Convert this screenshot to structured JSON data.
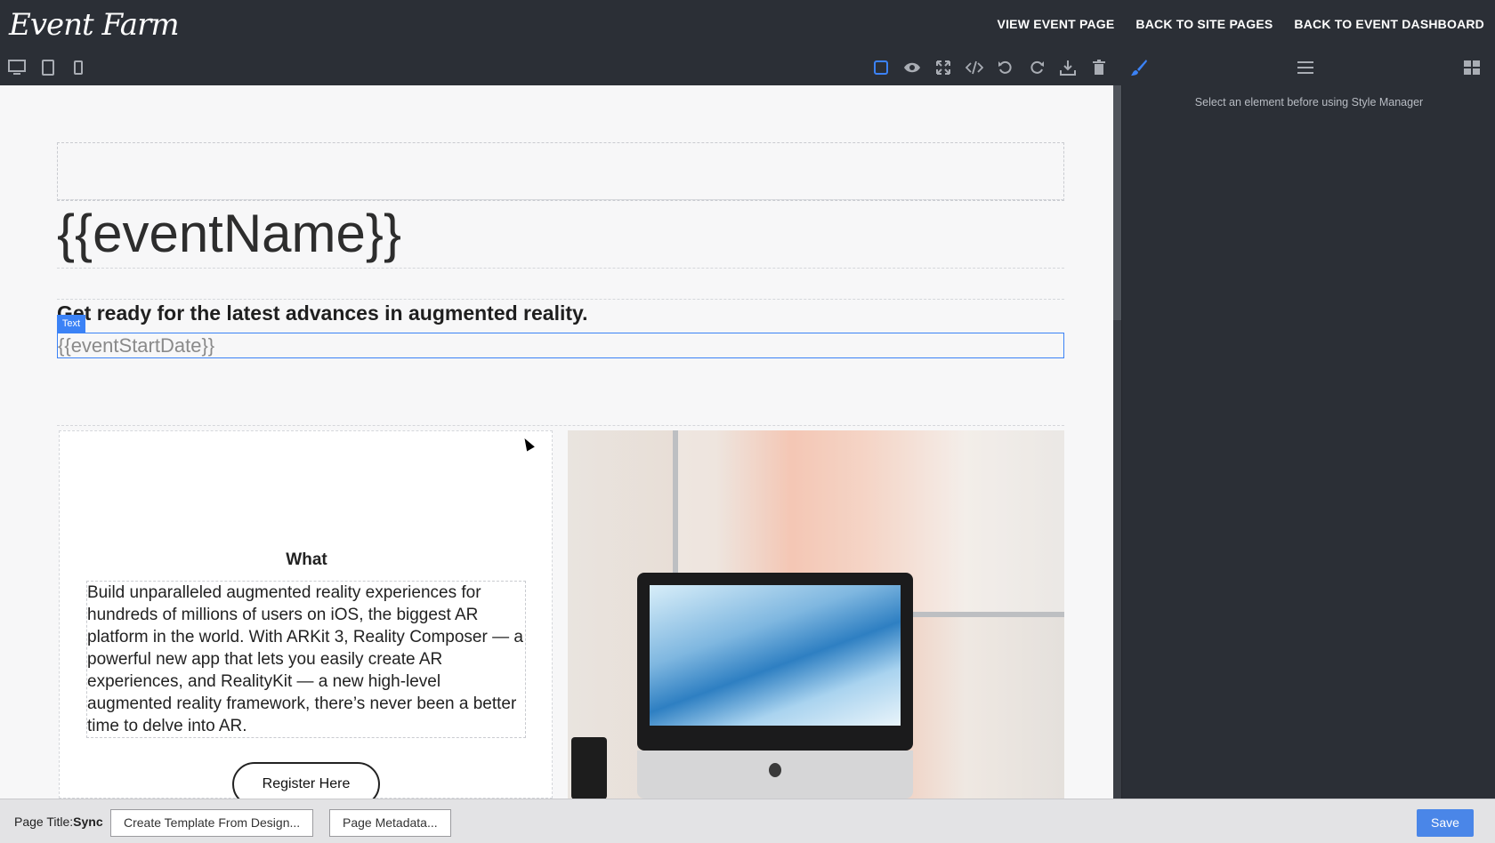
{
  "app": {
    "logo_text": "Event Farm",
    "nav": [
      "VIEW EVENT PAGE",
      "BACK TO SITE PAGES",
      "BACK TO EVENT DASHBOARD"
    ]
  },
  "toolbar": {
    "device_icons": [
      "desktop-icon",
      "tablet-icon",
      "mobile-icon"
    ],
    "tool_icons": [
      "select-outline-icon",
      "preview-eye-icon",
      "fullscreen-icon",
      "code-icon",
      "undo-icon",
      "redo-icon",
      "download-icon",
      "trash-icon"
    ],
    "panel_icons": [
      "style-brush-icon",
      "layers-menu-icon",
      "blocks-grid-icon"
    ],
    "accent": "#3b82f6"
  },
  "canvas": {
    "event_name": "{{eventName}}",
    "subtitle": "Get ready for the latest advances in augmented reality.",
    "selected_tag": "Text",
    "event_start_date": "{{eventStartDate}}",
    "section_heading": "What",
    "description": "Build unparalleled augmented reality experiences for hundreds of millions of users on iOS, the biggest AR platform in the world. With ARKit 3, Reality Composer — a powerful new app that lets you easily create AR experiences, and RealityKit — a new high-level augmented reality framework, there’s never been a better time to delve into AR.",
    "register_label": "Register Here"
  },
  "style_manager": {
    "hint": "Select an element before using Style Manager"
  },
  "footer": {
    "page_title_label": "Page Title:",
    "page_title_value": "Sync",
    "create_template_label": "Create Template From Design...",
    "page_metadata_label": "Page Metadata...",
    "save_label": "Save"
  }
}
